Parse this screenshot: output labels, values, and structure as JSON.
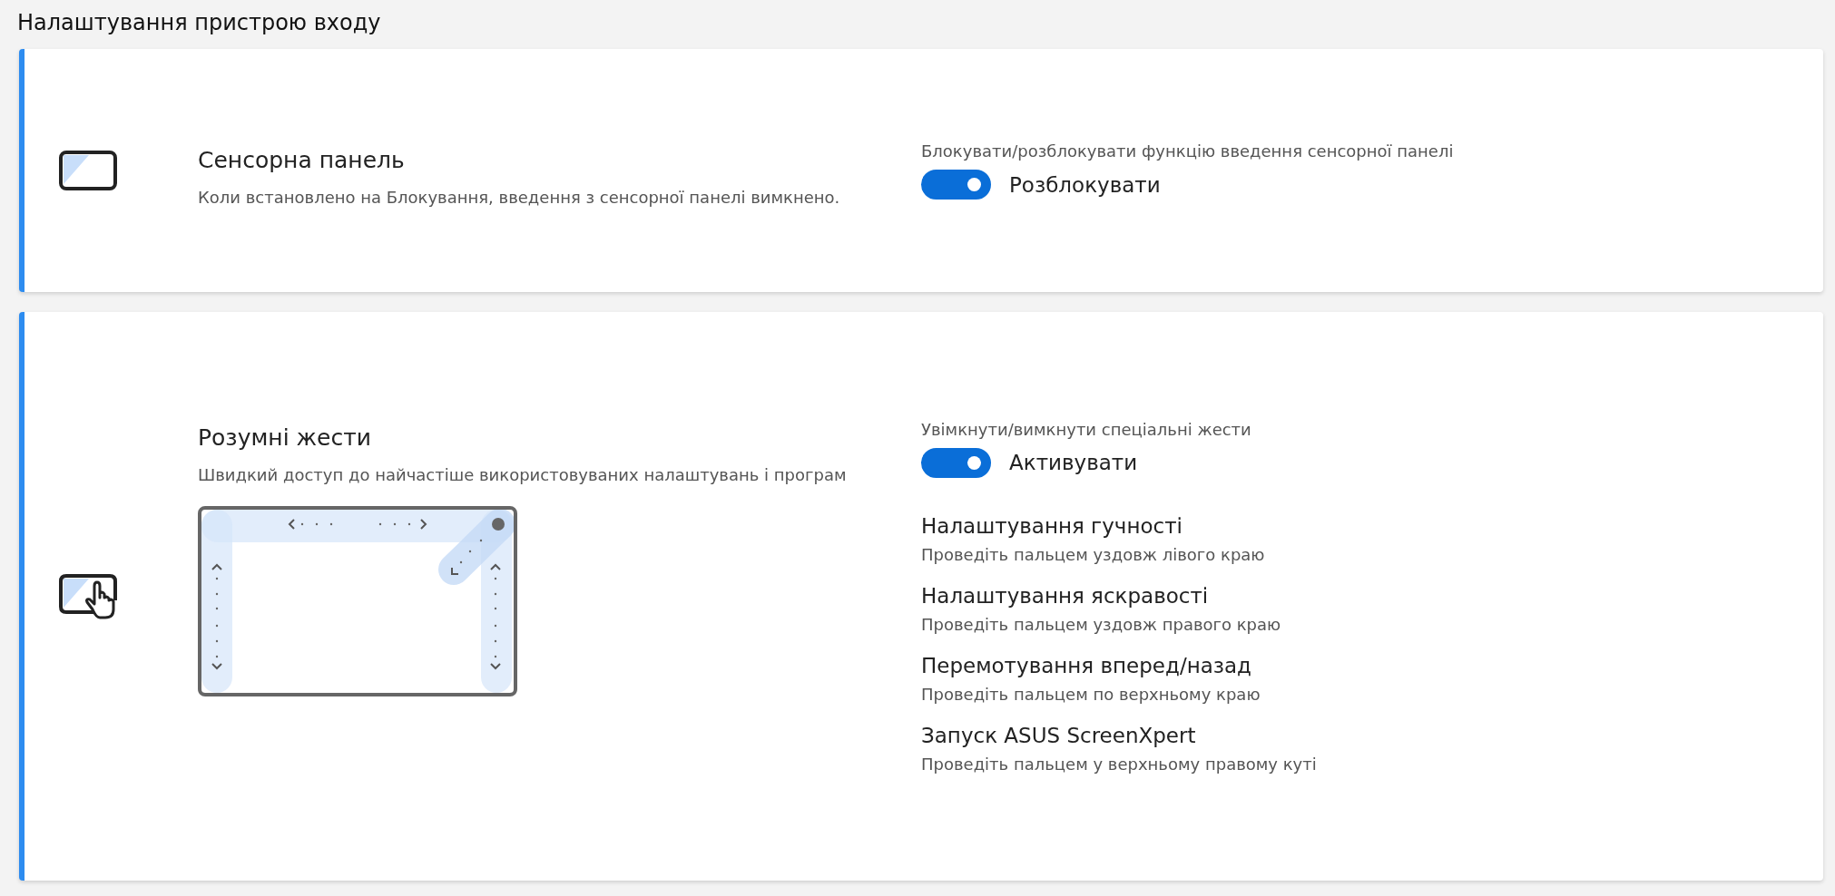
{
  "header": {
    "title": "Налаштування пристрою входу"
  },
  "cards": [
    {
      "kind": "touchpad",
      "title": "Сенсорна панель",
      "description": "Коли встановлено на Блокування, введення з сенсорної панелі вимкнено.",
      "control": {
        "label": "Блокувати/розблокувати функцію введення сенсорної панелі",
        "on": true,
        "state_label": "Розблокувати"
      }
    },
    {
      "kind": "gestures",
      "title": "Розумні жести",
      "description": "Швидкий доступ до найчастіше використовуваних налаштувань і програм",
      "control": {
        "label": "Увімкнути/вимкнути спеціальні жести",
        "on": true,
        "state_label": "Активувати"
      },
      "gestures": [
        {
          "title": "Налаштування гучності",
          "description": "Проведіть пальцем уздовж лівого краю"
        },
        {
          "title": "Налаштування яскравості",
          "description": "Проведіть пальцем уздовж правого краю"
        },
        {
          "title": "Перемотування вперед/назад",
          "description": "Проведіть пальцем по верхньому краю"
        },
        {
          "title": "Запуск ASUS ScreenXpert",
          "description": "Проведіть пальцем у верхньому правому куті"
        }
      ]
    }
  ]
}
